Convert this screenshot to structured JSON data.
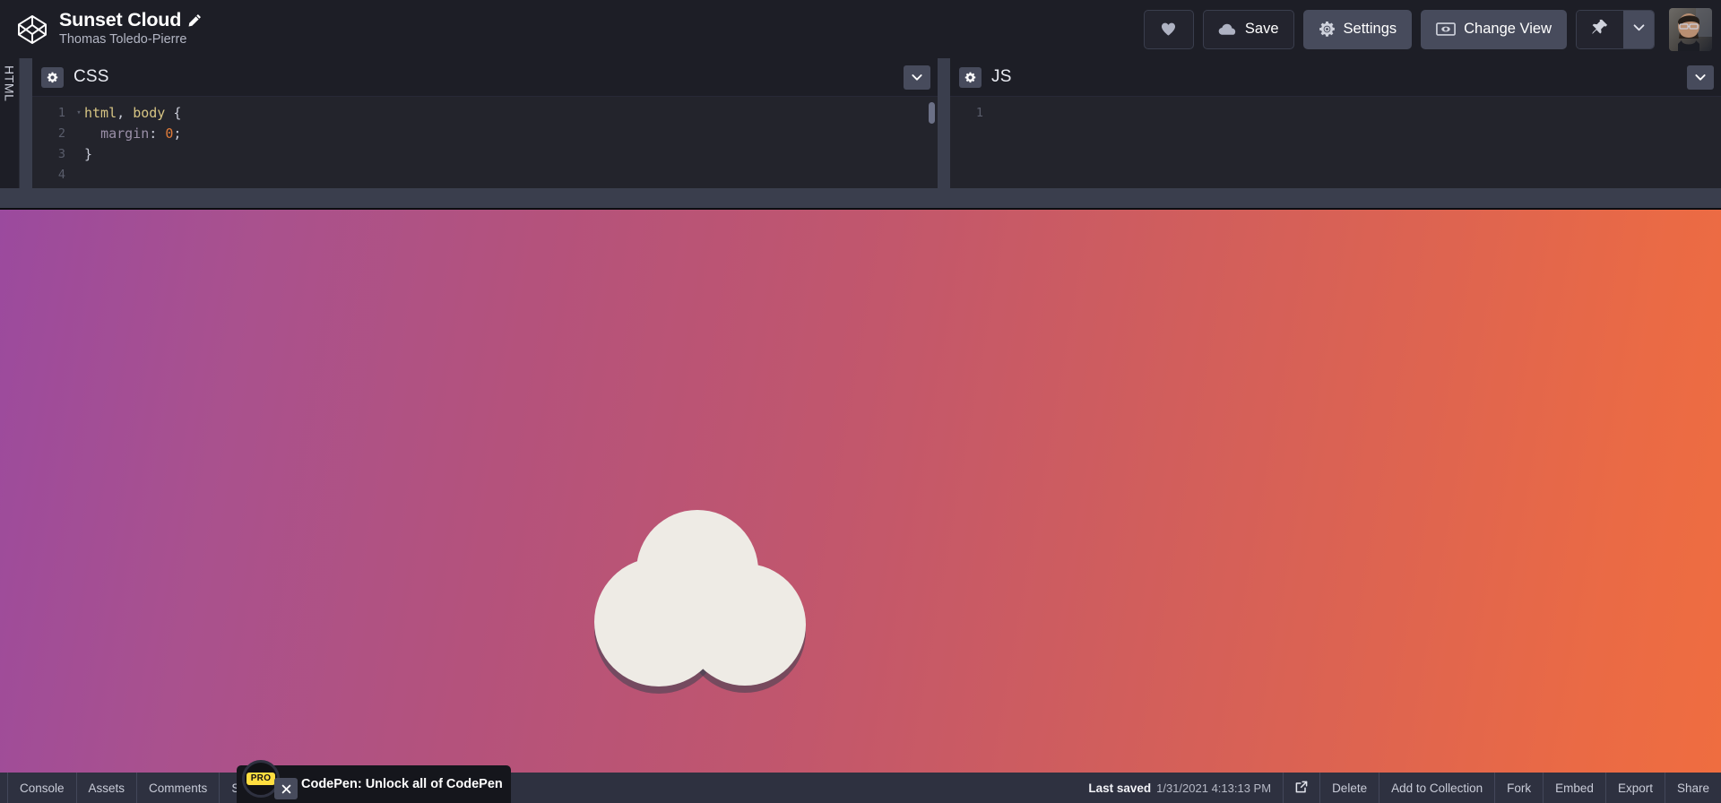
{
  "header": {
    "logo_icon": "codepen-logo",
    "pen_title": "Sunset Cloud",
    "edit_icon": "pencil-icon",
    "author": "Thomas Toledo-Pierre",
    "actions": {
      "love_icon": "heart-icon",
      "save_label": "Save",
      "save_icon": "cloud-icon",
      "settings_label": "Settings",
      "settings_icon": "gear-icon",
      "change_view_label": "Change View",
      "change_view_icon": "screen-icon",
      "pin_icon": "pushpin-icon",
      "pin_caret_icon": "chevron-down-icon",
      "avatar_alt": "user-avatar"
    }
  },
  "editors": {
    "html_tab_label": "HTML",
    "css": {
      "label": "CSS",
      "settings_icon": "gear-icon",
      "collapse_icon": "chevron-down-icon",
      "lines": [
        {
          "n": "1",
          "fold": "▾",
          "tokens": [
            {
              "t": "html",
              "c": "tk-sel"
            },
            {
              "t": ",",
              "c": "tk-punc"
            },
            {
              "t": " ",
              "c": "tk-punc"
            },
            {
              "t": "body",
              "c": "tk-sel"
            },
            {
              "t": " ",
              "c": "tk-punc"
            },
            {
              "t": "{",
              "c": "tk-punc"
            }
          ]
        },
        {
          "n": "2",
          "fold": "",
          "tokens": [
            {
              "t": "  ",
              "c": "tk-punc"
            },
            {
              "t": "margin",
              "c": "tk-prop"
            },
            {
              "t": ":",
              "c": "tk-punc"
            },
            {
              "t": " ",
              "c": "tk-punc"
            },
            {
              "t": "0",
              "c": "tk-num"
            },
            {
              "t": ";",
              "c": "tk-punc"
            }
          ]
        },
        {
          "n": "3",
          "fold": "",
          "tokens": [
            {
              "t": "}",
              "c": "tk-punc"
            }
          ]
        },
        {
          "n": "4",
          "fold": "",
          "tokens": []
        }
      ]
    },
    "js": {
      "label": "JS",
      "settings_icon": "gear-icon",
      "collapse_icon": "chevron-down-icon",
      "lines": [
        {
          "n": "1",
          "fold": "",
          "tokens": []
        }
      ]
    }
  },
  "preview": {
    "background_gradient_from": "#9b4a9e",
    "background_gradient_to": "#ef6d40",
    "cloud_color": "#eeebe5",
    "cloud_shadow_color": "#3b4250"
  },
  "footer": {
    "left_items": [
      {
        "label": "Console",
        "name": "console"
      },
      {
        "label": "Assets",
        "name": "assets"
      },
      {
        "label": "Comments",
        "name": "comments"
      },
      {
        "label": "Shortcuts",
        "name": "shortcuts"
      }
    ],
    "last_saved_label": "Last saved",
    "last_saved_time": "1/31/2021 4:13:13 PM",
    "open_external_icon": "external-link-icon",
    "right_items": [
      {
        "label": "Delete",
        "name": "delete"
      },
      {
        "label": "Add to Collection",
        "name": "add-to-collection"
      },
      {
        "label": "Fork",
        "name": "fork"
      },
      {
        "label": "Embed",
        "name": "embed"
      },
      {
        "label": "Export",
        "name": "export"
      },
      {
        "label": "Share",
        "name": "share"
      }
    ]
  },
  "promo": {
    "badge_text": "PRO",
    "text": "CodePen: Unlock all of CodePen",
    "close_icon": "close-icon"
  }
}
